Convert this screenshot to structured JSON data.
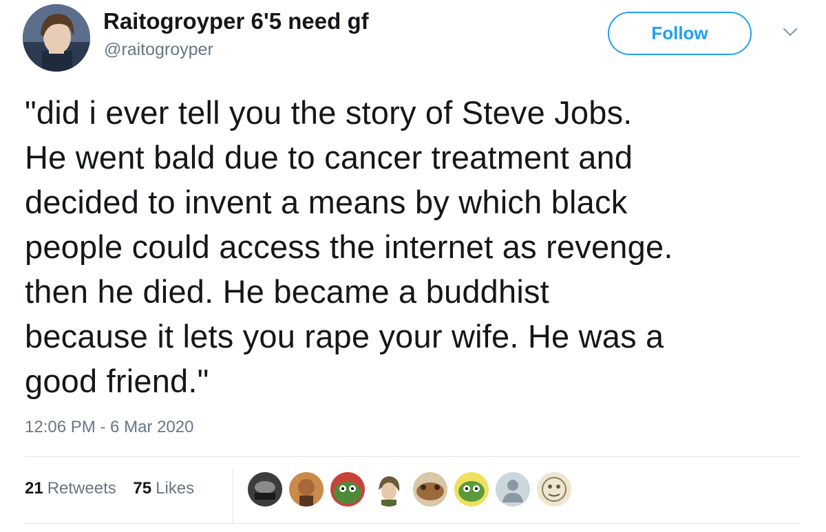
{
  "user": {
    "display_name": "Raitogroyper 6'5 need gf",
    "handle": "@raitogroyper"
  },
  "actions": {
    "follow_label": "Follow",
    "menu_icon": "chevron-down-icon"
  },
  "tweet": {
    "text": "\"did i ever tell you the story of Steve Jobs.\nHe went bald due to cancer treatment and\ndecided to invent a means by which black\npeople could access the internet as revenge.\nthen he died. He became a buddhist\nbecause it lets you rape your wife. He was a\ngood friend.\"",
    "timestamp": "12:06 PM - 6 Mar 2020"
  },
  "stats": {
    "retweets_count": "21",
    "retweets_label": "Retweets",
    "likes_count": "75",
    "likes_label": "Likes"
  },
  "likers": [
    "avatar-dark",
    "avatar-face",
    "avatar-frog",
    "avatar-anime",
    "avatar-toad",
    "avatar-frog-green",
    "avatar-default",
    "avatar-sketch"
  ],
  "colors": {
    "accent": "#1da1f2",
    "text": "#14171a",
    "muted": "#657786",
    "divider": "#e1e8ed"
  }
}
